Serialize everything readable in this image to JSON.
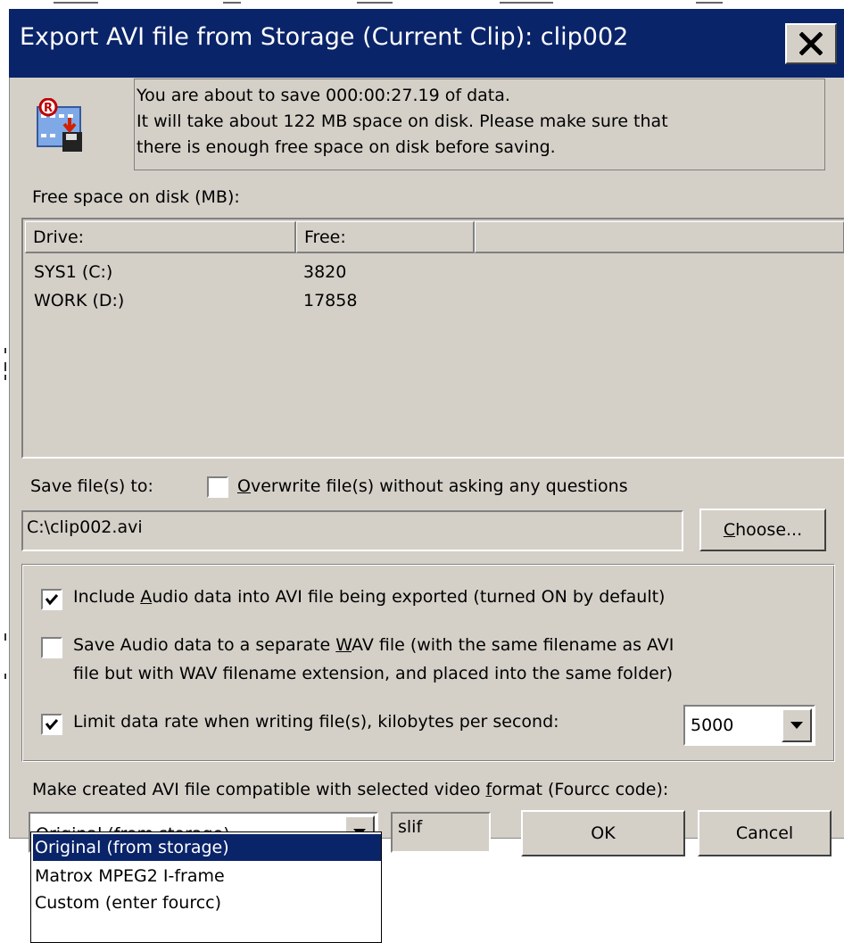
{
  "window": {
    "title": "Export AVI file from Storage (Current Clip): clip002",
    "close_glyph": "✕"
  },
  "info": {
    "line1": "You are about to save 000:00:27.19 of data.",
    "line2": "It will take about 122 MB space on disk. Please make sure that",
    "line3": "there is enough free space on disk before saving."
  },
  "free_space_label": "Free space on disk (MB):",
  "drives": {
    "columns": [
      "Drive:",
      "Free:",
      ""
    ],
    "rows": [
      {
        "drive": "SYS1 (C:)",
        "free": "3820"
      },
      {
        "drive": "WORK (D:)",
        "free": "17858"
      }
    ]
  },
  "save_to": {
    "label": "Save file(s) to:",
    "overwrite_label_pre": "",
    "overwrite_label_u": "O",
    "overwrite_label_post": "verwrite file(s) without asking any questions",
    "overwrite_checked": false,
    "path_value": "C:\\clip002.avi",
    "choose_u": "C",
    "choose_post": "hoose..."
  },
  "options": {
    "include_audio_pre": "Include ",
    "include_audio_u": "A",
    "include_audio_post": "udio data into AVI file being exported (turned ON by default)",
    "include_audio_checked": true,
    "wav_line1_pre": "Save Audio data to a separate ",
    "wav_line1_u": "W",
    "wav_line1_post": "AV file (with the same filename as AVI",
    "wav_line2": "file but with WAV filename extension, and placed into the same folder)",
    "wav_checked": false,
    "limit_label": "Limit data rate when writing file(s), kilobytes per second:",
    "limit_checked": true,
    "limit_value": "5000"
  },
  "format": {
    "label_pre": "Make created AVI file compatible with selected video ",
    "label_u": "f",
    "label_post": "ormat (Fourcc code):",
    "selected": "Original (from storage)",
    "fourcc": "slif",
    "options": [
      "Original (from storage)",
      "Matrox MPEG2 I-frame",
      "Custom (enter fourcc)"
    ]
  },
  "buttons": {
    "ok": "OK",
    "cancel": "Cancel"
  },
  "colors": {
    "titlebar": "#0a246a",
    "face": "#d4d0c8",
    "selection": "#0a246a"
  }
}
